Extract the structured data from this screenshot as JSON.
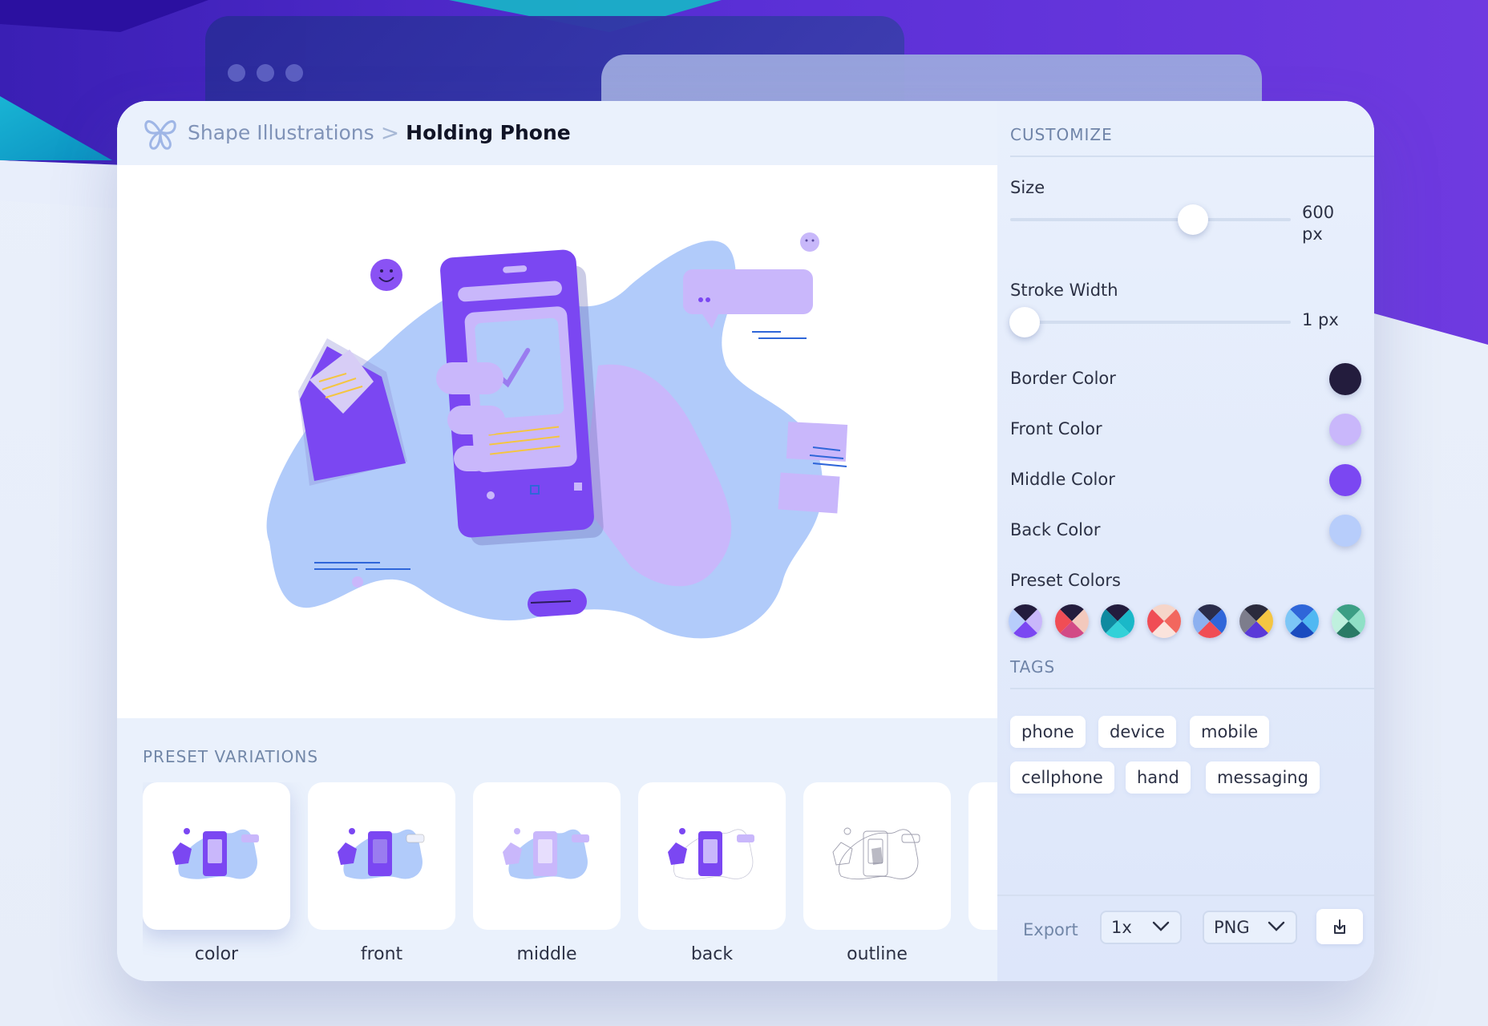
{
  "breadcrumb": {
    "parent": "Shape Illustrations",
    "separator": ">",
    "current": "Holding Phone"
  },
  "presets": {
    "title": "PRESET VARIATIONS",
    "items": [
      {
        "label": "color",
        "active": true
      },
      {
        "label": "front",
        "active": false
      },
      {
        "label": "middle",
        "active": false
      },
      {
        "label": "back",
        "active": false
      },
      {
        "label": "outline",
        "active": false
      }
    ]
  },
  "customize": {
    "title": "CUSTOMIZE",
    "size": {
      "label": "Size",
      "value": "600",
      "unit": "px",
      "fraction": 0.65
    },
    "stroke": {
      "label": "Stroke Width",
      "value": "1 px",
      "fraction": 0.05
    },
    "colors": [
      {
        "label": "Border Color",
        "hex": "#231c3d"
      },
      {
        "label": "Front Color",
        "hex": "#c9b7fb"
      },
      {
        "label": "Middle Color",
        "hex": "#7b47f2"
      },
      {
        "label": "Back Color",
        "hex": "#b7cdfb"
      }
    ],
    "preset_colors_label": "Preset Colors",
    "preset_colors": [
      [
        "#231c3d",
        "#c9b7fb",
        "#7b47f2",
        "#b7cdfb"
      ],
      [
        "#231c3d",
        "#f3c9bd",
        "#d24a86",
        "#f04d55"
      ],
      [
        "#231c3d",
        "#1ab8c8",
        "#33d1d8",
        "#0f8aa0"
      ],
      [
        "#f6d5c9",
        "#f2675e",
        "#fbe3dc",
        "#f04d55"
      ],
      [
        "#2a2c4a",
        "#2f66d9",
        "#f04d55",
        "#8cb0f0"
      ],
      [
        "#2a2a3c",
        "#f4c542",
        "#5a39d8",
        "#7d7d8c"
      ],
      [
        "#2f66d9",
        "#50b8f2",
        "#1a4bbf",
        "#7cc6f6"
      ],
      [
        "#3b9e84",
        "#8fe0c6",
        "#2a7a66",
        "#bff0de"
      ]
    ]
  },
  "tags": {
    "title": "TAGS",
    "items": [
      "phone",
      "device",
      "mobile",
      "cellphone",
      "hand",
      "messaging"
    ]
  },
  "export": {
    "label": "Export",
    "scale": "1x",
    "format": "PNG"
  },
  "icons": {
    "logo": "butterfly-logo-icon",
    "download": "download-icon",
    "chevron": "chevron-down-icon"
  }
}
